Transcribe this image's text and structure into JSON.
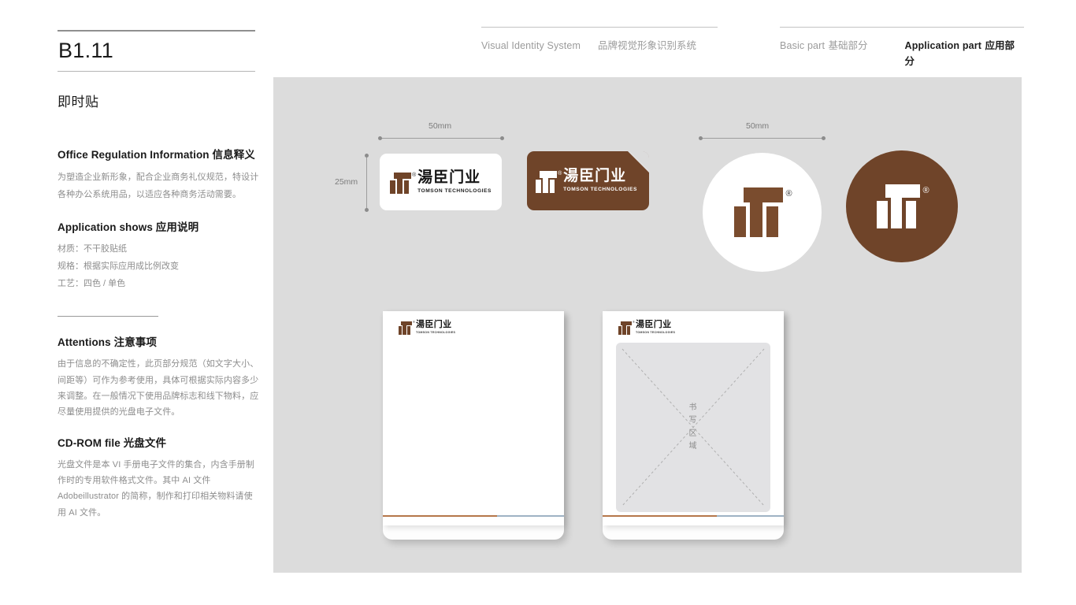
{
  "header": {
    "left_group": {
      "en": "Visual Identity System",
      "cn": "品牌视觉形象识别系统"
    },
    "right_group": {
      "basic_en": "Basic part",
      "basic_cn": "基础部分",
      "app_en": "Application part",
      "app_cn": "应用部分"
    }
  },
  "sidebar": {
    "doc_code": "B1.11",
    "doc_title": "即时贴",
    "sections": [
      {
        "heading": "Office Regulation Information 信息释义",
        "body": "为塑造企业新形象，配合企业商务礼仪规范，特设计各种办公系统用品，以适应各种商务活动需要。"
      },
      {
        "heading": "Application shows 应用说明",
        "lines": [
          "材质：不干胶贴纸",
          "规格：根据实际应用成比例改变",
          "工艺：四色 / 单色"
        ]
      },
      {
        "heading": "Attentions 注意事项",
        "body": "由于信息的不确定性，此页部分规范（如文字大小、间距等）可作为参考使用，具体可根据实际内容多少来调整。在一般情况下使用品牌标志和线下物料，应尽量使用提供的光盘电子文件。"
      },
      {
        "heading": "CD-ROM file 光盘文件",
        "body": "光盘文件是本 VI 手册电子文件的集合，内含手册制作时的专用软件格式文件。其中 AI 文件 Adobeillustrator 的简称，制作和打印相关物料请使用 AI 文件。"
      }
    ]
  },
  "stage": {
    "dimensions": {
      "sticker_width": "50mm",
      "sticker_height": "25mm",
      "circle_width": "50mm"
    },
    "brand": {
      "cn_wordmark": "湯臣门业",
      "en_wordmark": "TOMSON TECHNOLOGIES",
      "registered": "®"
    },
    "notepad": {
      "write_area_label": [
        "书",
        "写",
        "区",
        "域"
      ]
    }
  },
  "colors": {
    "brand_brown": "#6f4429",
    "stage_grey": "#dcdcdc",
    "rule_grey": "#9d9d9d",
    "accent_brown_line": "#b5764a",
    "accent_blue_line": "#9fb3c4",
    "text_dark": "#1a1a1a",
    "text_muted": "#8d8d8d"
  }
}
